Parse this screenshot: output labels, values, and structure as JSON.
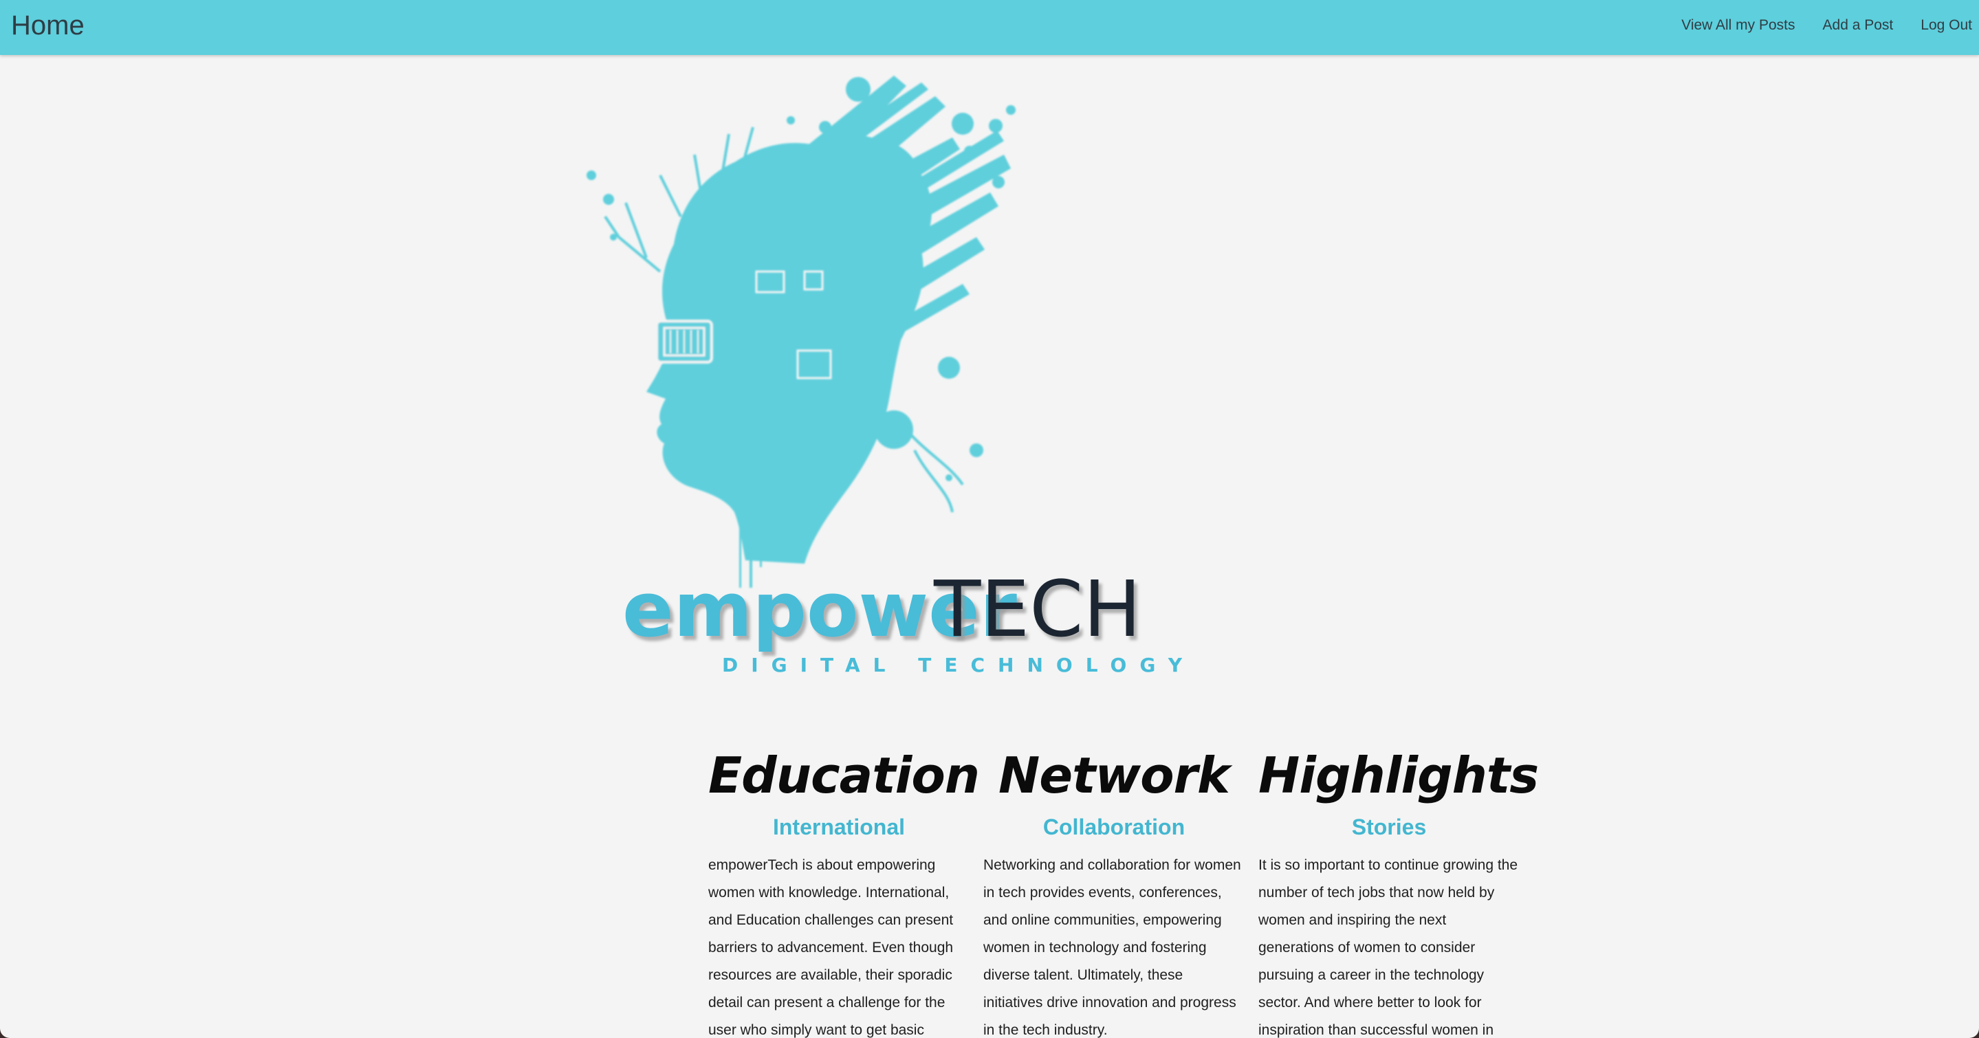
{
  "navbar": {
    "brand": "Home",
    "links": [
      "View All my Posts",
      "Add a Post",
      "Log Out"
    ]
  },
  "logo": {
    "word_light": "empower",
    "word_dark": "TECH",
    "tagline": "DIGITAL TECHNOLOGY",
    "accent_color": "#5ecfdc",
    "dark_color": "#1f2530"
  },
  "columns": [
    {
      "title": "Education",
      "subtitle": "International",
      "text": "empowerTech is about empowering women with knowledge. International, and Education challenges can present barriers to advancement. Even though resources are available, their sporadic detail can present a challenge for the user who simply want to get basic"
    },
    {
      "title": "Network",
      "subtitle": "Collaboration",
      "text": "Networking and collaboration for women in tech provides events, conferences, and online communities, empowering women in technology and fostering diverse talent. Ultimately, these initiatives drive innovation and progress in the tech industry."
    },
    {
      "title": "Highlights",
      "subtitle": "Stories",
      "text": "It is so important to continue growing the number of tech jobs that now held by women and inspiring the next generations of women to consider pursuing a career in the technology sector. And where better to look for inspiration than successful women in"
    }
  ]
}
